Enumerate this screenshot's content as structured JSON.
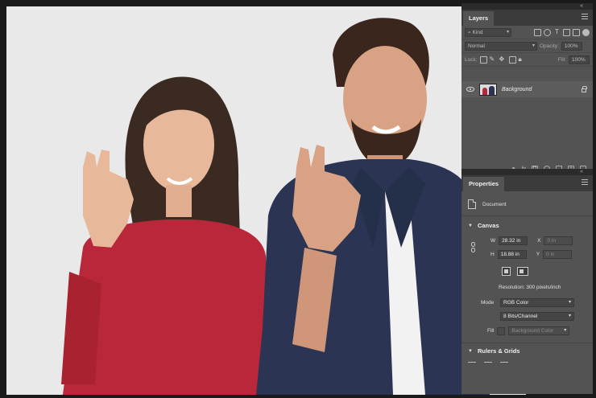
{
  "layers_panel": {
    "tab_label": "Layers",
    "filter": {
      "kind": "Kind"
    },
    "blend": {
      "mode": "Normal",
      "opacity_label": "Opacity:",
      "opacity_value": "100%"
    },
    "lock": {
      "label": "Lock:",
      "fill_label": "Fill:",
      "fill_value": "100%"
    },
    "layer": {
      "name": "Background"
    },
    "footer": {
      "fx_label": "fx"
    }
  },
  "properties_panel": {
    "tab_label": "Properties",
    "document_label": "Document",
    "canvas": {
      "section_label": "Canvas",
      "w_label": "W",
      "w_value": "28.32 in",
      "h_label": "H",
      "h_value": "18.88 in",
      "x_label": "X",
      "x_value": "0 in",
      "y_label": "Y",
      "y_value": "0 in",
      "resolution": "Resolution: 300 pixels/inch",
      "mode_label": "Mode",
      "mode_value": "RGB Color",
      "depth_value": "8 Bits/Channel",
      "fill_label": "Fill",
      "fill_value": "Background Color"
    },
    "rulers": {
      "section_label": "Rulers & Grids"
    }
  },
  "colors": {
    "panel_bg": "#535353",
    "tab_bar": "#3b3b3b",
    "woman_shirt": "#b8283a",
    "man_shirt": "#2b3553",
    "canvas_bg": "#e9e9e9"
  }
}
